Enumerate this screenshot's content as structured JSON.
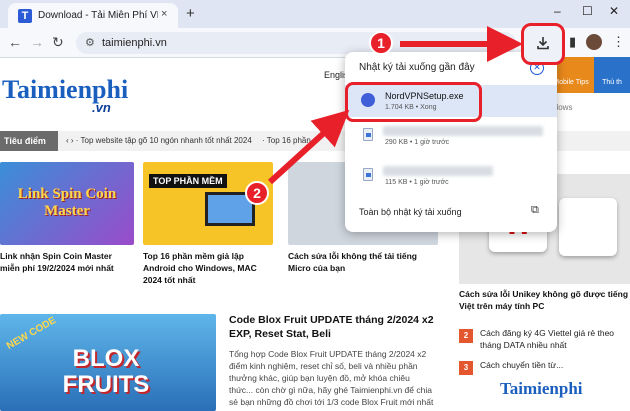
{
  "browser": {
    "tab_title": "Download - Tải Miễn Phí VN - P",
    "tab_favicon": "T",
    "close_glyph": "×",
    "new_tab_glyph": "+",
    "url": "taimienphi.vn",
    "window": {
      "minimize": "–",
      "maximize": "☐",
      "close": "✕"
    }
  },
  "site": {
    "logo": "Taimienphi",
    "logo_suffix": ".vn",
    "english_link": "English",
    "ticker_label": "Tiêu điểm",
    "ticker_items": [
      "Top website tập gõ 10 ngón nhanh tốt nhất 2024",
      "Top 16 phần"
    ],
    "right_tabs": [
      "Mobile Tips",
      "Thủ th"
    ],
    "windows_select": "Windows"
  },
  "articles": [
    {
      "title": "Link nhận Spin Coin Master miễn phí 19/2/2024 mới nhất",
      "thumb_text": "Link Spin Coin Master"
    },
    {
      "title": "Top 16 phần mềm giả lập Android cho Windows, MAC 2024 tốt nhất",
      "thumb_text": "TOP PHẦN MỀM"
    },
    {
      "title": "Cách sửa lỗi không thể tải tiếng Micro của bạn",
      "thumb_text": ""
    }
  ],
  "featured": {
    "title": "Code Blox Fruit UPDATE tháng 2/2024 x2 EXP, Reset Stat, Beli",
    "description": "Tổng hợp Code Blox Fruit UPDATE tháng 2/2024 x2 điểm kinh nghiệm, reset chỉ số, beli và nhiều phần thưởng khác, giúp bạn luyện đồ, mở khóa chiêu thức... còn chờ gì nữa, hãy ghé Taimienphi.vn để chia sẻ bạn những đồ chơi tới 1/3 code Blox Fruit mới nhất",
    "thumb_text": "BLOX FRUITS",
    "new_code": "NEW CODE"
  },
  "sidebar": {
    "feature_title": "Cách sửa lỗi Unikey không gõ được tiếng Việt trên máy tính PC",
    "items": [
      {
        "num": "2",
        "text": "Cách đăng ký 4G Viettel giá rẻ theo tháng DATA nhiều nhất"
      },
      {
        "num": "3",
        "text": "Cách chuyển tiền từ..."
      }
    ],
    "watermark": "Taimienphi"
  },
  "downloads": {
    "title": "Nhật ký tải xuống gần đây",
    "items": [
      {
        "name": "NordVPNSetup.exe",
        "meta": "1.704 KB • Xong"
      },
      {
        "name": "",
        "meta": "290 KB • 1 giờ trước"
      },
      {
        "name": "",
        "meta": "115 KB • 1 giờ trước"
      }
    ],
    "footer": "Toàn bộ nhật ký tải xuống"
  },
  "steps": [
    "1",
    "2"
  ],
  "colors": {
    "highlight": "#e8202a",
    "brand": "#1b5fbe"
  }
}
